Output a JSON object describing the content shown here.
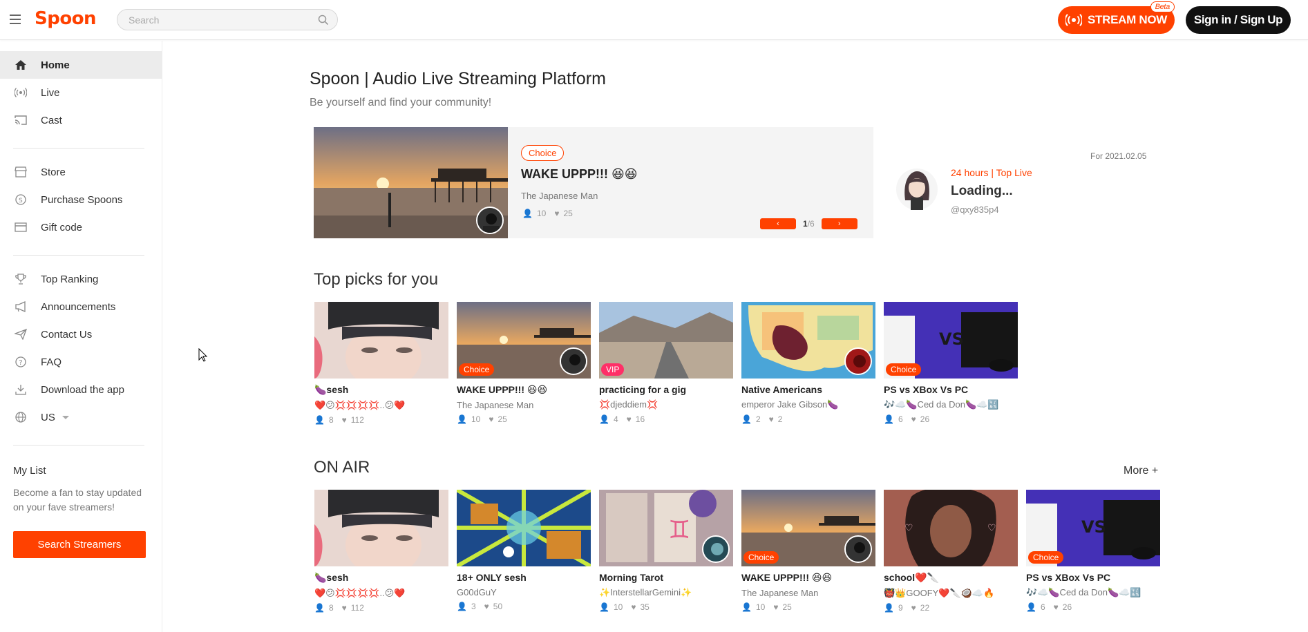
{
  "header": {
    "logo": "Spoon",
    "search_placeholder": "Search",
    "stream_label": "STREAM NOW",
    "beta": "Beta",
    "signin_label": "Sign in / Sign Up"
  },
  "sidebar": {
    "groups": [
      [
        {
          "label": "Home",
          "icon": "home-icon",
          "active": true
        },
        {
          "label": "Live",
          "icon": "broadcast-icon"
        },
        {
          "label": "Cast",
          "icon": "cast-icon"
        }
      ],
      [
        {
          "label": "Store",
          "icon": "store-icon"
        },
        {
          "label": "Purchase Spoons",
          "icon": "spoon-coin-icon"
        },
        {
          "label": "Gift code",
          "icon": "card-icon"
        }
      ],
      [
        {
          "label": "Top Ranking",
          "icon": "trophy-icon"
        },
        {
          "label": "Announcements",
          "icon": "megaphone-icon"
        },
        {
          "label": "Contact Us",
          "icon": "paper-plane-icon"
        },
        {
          "label": "FAQ",
          "icon": "question-icon"
        },
        {
          "label": "Download the app",
          "icon": "download-icon"
        },
        {
          "label": "US",
          "icon": "globe-icon"
        }
      ]
    ],
    "mylist_title": "My List",
    "mylist_desc": "Become a fan to stay updated on your fave streamers!",
    "search_streamers": "Search Streamers"
  },
  "main": {
    "title": "Spoon | Audio Live Streaming Platform",
    "subtitle": "Be yourself and find your community!",
    "hero": {
      "badge": "Choice",
      "title": "WAKE UPPP!!! 😆😆",
      "author": "The Japanese Man",
      "listeners": "10",
      "likes": "25",
      "page_current": "1",
      "page_total": "/6"
    },
    "top_live": {
      "date": "For 2021.02.05",
      "label": "24 hours | Top Live",
      "title": "Loading...",
      "handle": "@qxy835p4"
    },
    "top_picks_title": "Top picks for you",
    "top_picks": [
      {
        "title": "🍆sesh",
        "author": "❤️😕💢💢💢💢..😕❤️",
        "listeners": "8",
        "likes": "112",
        "badge": "",
        "thumb": "girl"
      },
      {
        "title": "WAKE UPPP!!! 😆😆",
        "author": "The Japanese Man",
        "listeners": "10",
        "likes": "25",
        "badge": "Choice",
        "thumb": "sunset"
      },
      {
        "title": "practicing for a gig",
        "author": "💢djeddiem💢",
        "listeners": "4",
        "likes": "16",
        "badge": "VIP",
        "thumb": "road"
      },
      {
        "title": "Native Americans",
        "author": "emperor Jake Gibson🍆",
        "listeners": "2",
        "likes": "2",
        "badge": "",
        "thumb": "map"
      },
      {
        "title": "PS vs XBox Vs PC",
        "author": "🎶☁️🍆Ced da Don🍆☁️🔣",
        "listeners": "6",
        "likes": "26",
        "badge": "Choice",
        "thumb": "consoles"
      }
    ],
    "on_air_title": "ON AIR",
    "more_label": "More +",
    "on_air": [
      {
        "title": "🍆sesh",
        "author": "❤️😕💢💢💢💢..😕❤️",
        "listeners": "8",
        "likes": "112",
        "badge": "",
        "thumb": "girl"
      },
      {
        "title": "18+ ONLY sesh",
        "author": "G00dGuY",
        "listeners": "3",
        "likes": "50",
        "badge": "",
        "thumb": "psychedelic"
      },
      {
        "title": "Morning Tarot",
        "author": "✨InterstellarGemini✨",
        "listeners": "10",
        "likes": "35",
        "badge": "",
        "thumb": "tarot"
      },
      {
        "title": "WAKE UPPP!!! 😆😆",
        "author": "The Japanese Man",
        "listeners": "10",
        "likes": "25",
        "badge": "Choice",
        "thumb": "sunset"
      },
      {
        "title": "school❤️🔪",
        "author": "👹👑GOOFY❤️🔪🥥☁️🔥",
        "listeners": "9",
        "likes": "22",
        "badge": "",
        "thumb": "portrait"
      },
      {
        "title": "PS vs XBox Vs PC",
        "author": "🎶☁️🍆Ced da Don🍆☁️🔣",
        "listeners": "6",
        "likes": "26",
        "badge": "Choice",
        "thumb": "consoles"
      }
    ]
  },
  "colors": {
    "brand": "#ff4100",
    "vip": "#ff2f67"
  }
}
